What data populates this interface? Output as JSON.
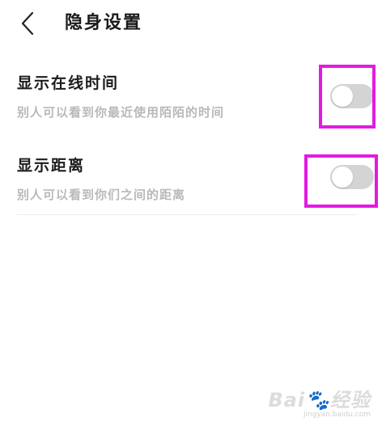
{
  "header": {
    "title": "隐身设置",
    "back_icon": "chevron-left-icon"
  },
  "settings": [
    {
      "title": "显示在线时间",
      "description": "别人可以看到你最近使用陌陌的时间",
      "toggle_on": false
    },
    {
      "title": "显示距离",
      "description": "别人可以看到你们之间的距离",
      "toggle_on": false
    }
  ],
  "watermark": {
    "logo": "Bai🐾经验",
    "url": "jingyan.baidu.com"
  },
  "colors": {
    "toggle_off": "#d4d4d4",
    "highlight": "#e21be0",
    "description_text": "#b9b9b9"
  }
}
